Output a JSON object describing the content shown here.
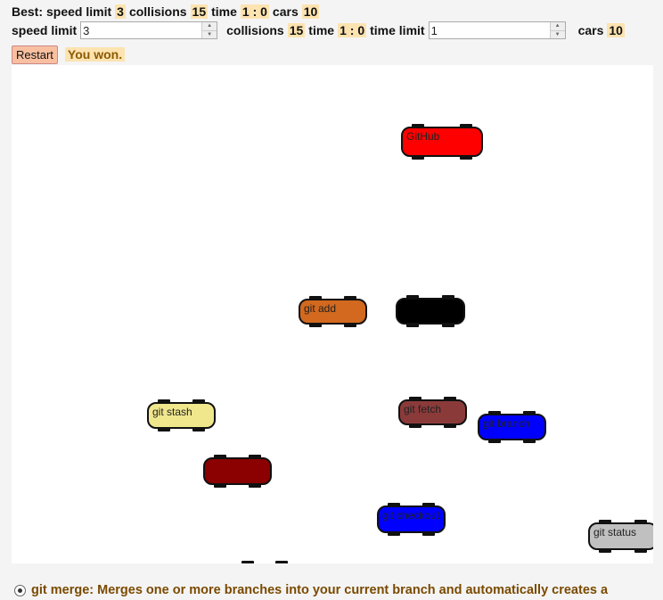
{
  "best": {
    "label": "Best:",
    "speed_limit_label": "speed limit",
    "speed_limit_value": "3",
    "collisions_label": "collisions",
    "collisions_value": "15",
    "time_label": "time",
    "time_value": "1 : 0",
    "cars_label": "cars",
    "cars_value": "10"
  },
  "current": {
    "speed_limit_label": "speed limit",
    "speed_limit_input": "3",
    "collisions_label": "collisions",
    "collisions_value": "15",
    "time_label": "time",
    "time_value": "1 : 0",
    "time_limit_label": "time limit",
    "time_limit_input": "1",
    "cars_label": "cars",
    "cars_value": "10"
  },
  "controls": {
    "restart_label": "Restart",
    "status_message": "You won."
  },
  "cars": [
    {
      "label": "GitHub",
      "color": "#ff0000",
      "text_color": "#222222"
    },
    {
      "label": "git add",
      "color": "#d2691e",
      "text_color": "#222222"
    },
    {
      "label": "",
      "color": "#000000",
      "text_color": "#ffffff"
    },
    {
      "label": "git stash",
      "color": "#f0e68c",
      "text_color": "#222222"
    },
    {
      "label": "git fetch",
      "color": "#8b3a3a",
      "text_color": "#222222"
    },
    {
      "label": "git branch",
      "color": "#0000ff",
      "text_color": "#222222"
    },
    {
      "label": "",
      "color": "#8b0000",
      "text_color": "#ffffff"
    },
    {
      "label": "git checkout",
      "color": "#0000ff",
      "text_color": "#222222"
    },
    {
      "label": "git status",
      "color": "#c0c0c0",
      "text_color": "#222222"
    },
    {
      "label": "",
      "color": "#ffffff",
      "text_color": "#222222"
    }
  ],
  "description": {
    "text": "git merge: Merges one or more branches into your current branch and automatically creates a"
  },
  "colors": {
    "highlight": "#fde3b0",
    "status_text": "#8b5a00",
    "description_text": "#7a4a00",
    "restart_bg": "#f8c0a0"
  }
}
